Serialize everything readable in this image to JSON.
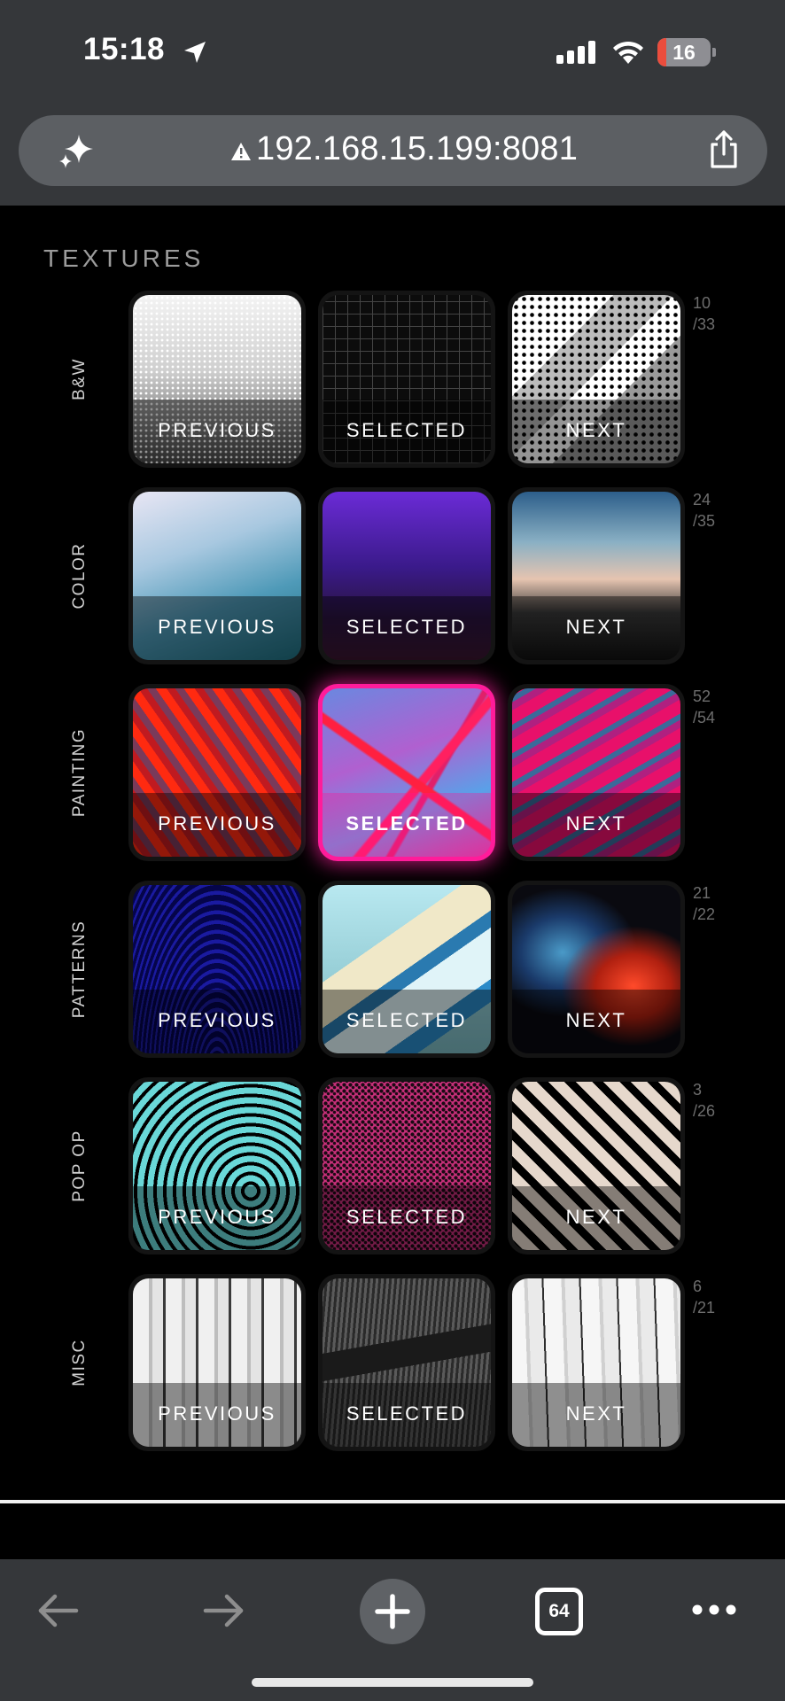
{
  "status_bar": {
    "time": "15:18",
    "battery_level": "16",
    "battery_fraction": 0.16,
    "icons": [
      "location-arrow-icon",
      "cellular-signal-icon",
      "wifi-icon",
      "battery-icon"
    ]
  },
  "url_bar": {
    "url": "192.168.15.199:8081",
    "left_icon": "sparkle-icon",
    "security_icon": "warning-icon",
    "right_icon": "share-icon"
  },
  "section_title": "TEXTURES",
  "rows": [
    {
      "label": "B&W",
      "index": "10",
      "total": "/33",
      "tiles": [
        {
          "label": "PREVIOUS"
        },
        {
          "label": "SELECTED"
        },
        {
          "label": "NEXT"
        }
      ]
    },
    {
      "label": "COLOR",
      "index": "24",
      "total": "/35",
      "tiles": [
        {
          "label": "PREVIOUS"
        },
        {
          "label": "SELECTED"
        },
        {
          "label": "NEXT"
        }
      ]
    },
    {
      "label": "PAINTING",
      "index": "52",
      "total": "/54",
      "tiles": [
        {
          "label": "PREVIOUS"
        },
        {
          "label": "SELECTED"
        },
        {
          "label": "NEXT"
        }
      ]
    },
    {
      "label": "PATTERNS",
      "index": "21",
      "total": "/22",
      "tiles": [
        {
          "label": "PREVIOUS"
        },
        {
          "label": "SELECTED"
        },
        {
          "label": "NEXT"
        }
      ]
    },
    {
      "label": "POP OP",
      "index": "3",
      "total": "/26",
      "tiles": [
        {
          "label": "PREVIOUS"
        },
        {
          "label": "SELECTED"
        },
        {
          "label": "NEXT"
        }
      ]
    },
    {
      "label": "MISC",
      "index": "6",
      "total": "/21",
      "tiles": [
        {
          "label": "PREVIOUS"
        },
        {
          "label": "SELECTED"
        },
        {
          "label": "NEXT"
        }
      ]
    }
  ],
  "active_row": "PAINTING",
  "colors": {
    "accent": "#ff1c9a",
    "chrome": "#35373a",
    "url_pill": "#5c5f63",
    "battery_low": "#eb4d3d"
  },
  "bottom_bar": {
    "tabs_count": "64",
    "icons": [
      "back-arrow-icon",
      "forward-arrow-icon",
      "plus-icon",
      "tabs-icon",
      "more-icon"
    ]
  }
}
